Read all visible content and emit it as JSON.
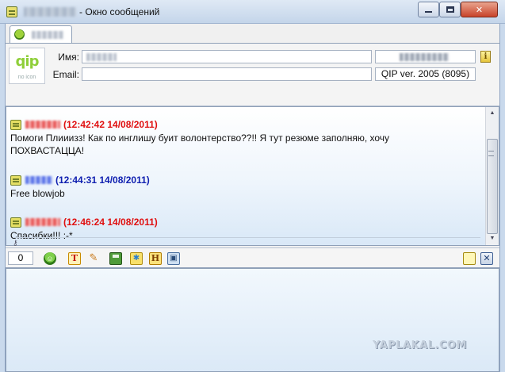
{
  "window": {
    "title": "- Окно сообщений",
    "buttons": {
      "minimize": "_",
      "maximize": "□",
      "close": "✕"
    }
  },
  "contact_info": {
    "logo_text": "qip",
    "logo_sub": "no icon",
    "name_label": "Имя:",
    "email_label": "Email:",
    "version": "QIP ver. 2005 (8095)"
  },
  "messages": [
    {
      "time": "(12:42:42 14/08/2011)",
      "color": "#e01010",
      "text": "Помоги Плииизз! Как по инглишу буит волонтерство??!! Я тут резюме заполняю, хочу ПОХВАСТАЦЦА!"
    },
    {
      "time": "(12:44:31 14/08/2011)",
      "color": "#1020b0",
      "text": "Free blowjob"
    },
    {
      "time": "(12:46:24 14/08/2011)",
      "color": "#e01010",
      "text": "Спасибки!!! :-*"
    }
  ],
  "toolbar": {
    "char_count": "0",
    "icons": [
      "smile-icon",
      "font-icon",
      "color-icon",
      "save-icon",
      "star-icon",
      "history-icon",
      "image-icon",
      "notes-icon",
      "close-icon"
    ],
    "font_glyph": "T",
    "history_glyph": "H"
  },
  "watermark": "YAPLAKAL.COM"
}
